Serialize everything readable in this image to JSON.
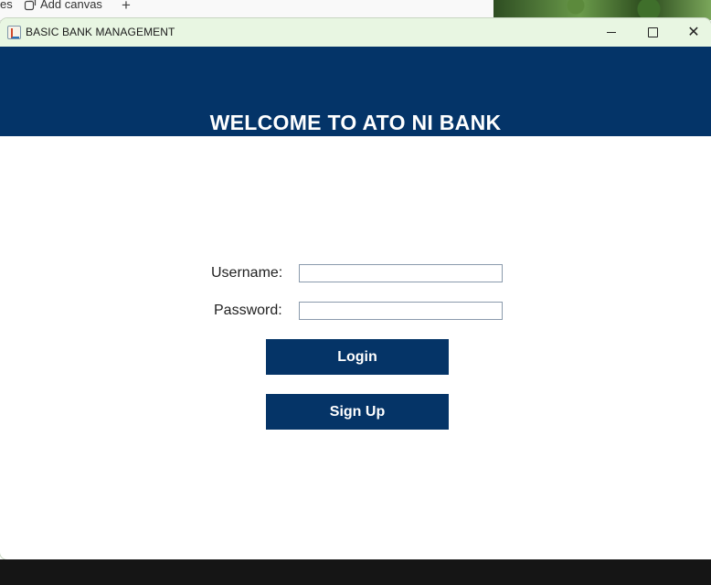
{
  "background": {
    "tab_fragment": "es",
    "canvas_tab_label": "Add canvas",
    "plus_symbol": "+"
  },
  "window": {
    "title": "BASIC BANK MANAGEMENT",
    "close_symbol": "✕"
  },
  "header": {
    "title": "WELCOME TO ATO NI BANK",
    "background_color": "#043468"
  },
  "form": {
    "username_label": "Username:",
    "username_value": "",
    "password_label": "Password:",
    "password_value": "",
    "login_label": "Login",
    "signup_label": "Sign Up"
  },
  "colors": {
    "accent": "#053467",
    "titlebar": "#e8f6e2"
  },
  "icons": {
    "app": "java-app-icon",
    "canvas": "canvas-icon",
    "minimize": "minimize-icon",
    "maximize": "maximize-icon",
    "close": "close-icon"
  }
}
